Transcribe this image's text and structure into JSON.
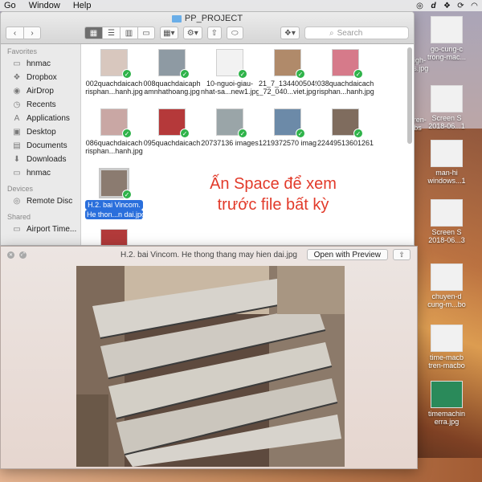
{
  "menubar": {
    "items": [
      "Go",
      "Window",
      "Help"
    ],
    "status_icons": [
      "creative-cloud-icon",
      "dictionary-icon",
      "dropbox-icon",
      "sync-icon",
      "wifi-icon"
    ]
  },
  "finder": {
    "title": "PP_PROJECT",
    "search_placeholder": "Search",
    "sidebar": {
      "favorites_header": "Favorites",
      "favorites": [
        {
          "label": "hnmac",
          "icon": "home-folder-icon"
        },
        {
          "label": "Dropbox",
          "icon": "dropbox-icon"
        },
        {
          "label": "AirDrop",
          "icon": "airdrop-icon"
        },
        {
          "label": "Recents",
          "icon": "clock-icon"
        },
        {
          "label": "Applications",
          "icon": "applications-icon"
        },
        {
          "label": "Desktop",
          "icon": "desktop-icon"
        },
        {
          "label": "Documents",
          "icon": "documents-icon"
        },
        {
          "label": "Downloads",
          "icon": "downloads-icon"
        },
        {
          "label": "hnmac",
          "icon": "folder-icon"
        }
      ],
      "devices_header": "Devices",
      "devices": [
        {
          "label": "Remote Disc",
          "icon": "disc-icon"
        }
      ],
      "shared_header": "Shared",
      "shared": [
        {
          "label": "Airport Time...",
          "icon": "display-icon"
        }
      ]
    },
    "files": [
      {
        "name1": "002quachdaicach",
        "name2": "risphan...hanh.jpg"
      },
      {
        "name1": "008quachdaicaph",
        "name2": "amnhathoang.jpg"
      },
      {
        "name1": "10-nguoi-giau-",
        "name2": "nhat-sa...new1.jpg"
      },
      {
        "name1": "21_7_1344005049",
        "name2": "_72_040...viet.jpg"
      },
      {
        "name1": "038quachdaicach",
        "name2": "risphan...hanh.jpg"
      },
      {
        "name1": "086quachdaicach",
        "name2": "risphan...hanh.jpg"
      },
      {
        "name1": "095quachdaicach",
        "name2": ""
      },
      {
        "name1": "20737136 images",
        "name2": ""
      },
      {
        "name1": "1219372570 image",
        "name2": ""
      },
      {
        "name1": "22449513601261",
        "name2": ""
      },
      {
        "name1": "H.2. bai Vincom.",
        "name2": "He thon...n dai.jpg"
      }
    ],
    "annotation": {
      "line1": "Ấn Space để xem",
      "line2": "trước file bất kỳ"
    }
  },
  "quicklook": {
    "title": "H.2. bai Vincom. He thong thang may hien dai.jpg",
    "open_button": "Open with Preview"
  },
  "desktop_icons": [
    {
      "l1": "go-cung-c",
      "l2": "trong-mac..."
    },
    {
      "l1": "nigh-",
      "l2": "nts.jpg"
    },
    {
      "l1": "Screen S",
      "l2": "2018-06...1"
    },
    {
      "l1": "-tren-",
      "l2": "bs"
    },
    {
      "l1": "man-hi",
      "l2": "windows...1"
    },
    {
      "l1": "Screen S",
      "l2": "2018-06...3"
    },
    {
      "l1": "chuyen-d",
      "l2": "cung-m...bo"
    },
    {
      "l1": "time-macb",
      "l2": "tren-macbo"
    },
    {
      "l1": "timemachin",
      "l2": "erra.jpg"
    }
  ]
}
